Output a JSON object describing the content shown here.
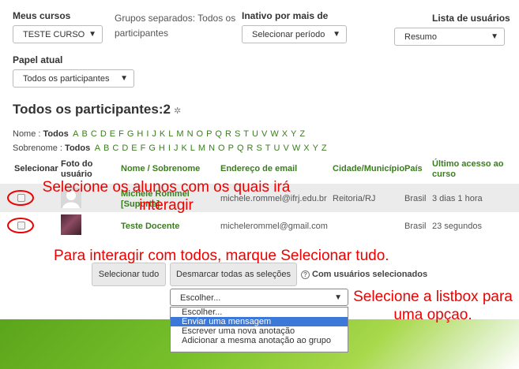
{
  "filters": {
    "my_courses_label": "Meus cursos",
    "my_courses_value": "TESTE CURSO",
    "groups_text": "Grupos separados: Todos os participantes",
    "inactive_label": "Inativo por mais de",
    "inactive_value": "Selecionar período",
    "user_list_label": "Lista de usuários",
    "user_list_value": "Resumo",
    "role_label": "Papel atual",
    "role_value": "Todos os participantes"
  },
  "heading": "Todos os participantes:2",
  "alphabet": {
    "name_label": "Nome :",
    "surname_label": "Sobrenome :",
    "all": "Todos",
    "letters": [
      "A",
      "B",
      "C",
      "D",
      "E",
      "F",
      "G",
      "H",
      "I",
      "J",
      "K",
      "L",
      "M",
      "N",
      "O",
      "P",
      "Q",
      "R",
      "S",
      "T",
      "U",
      "V",
      "W",
      "X",
      "Y",
      "Z"
    ]
  },
  "table": {
    "headers": {
      "select": "Selecionar",
      "photo": "Foto do usuário",
      "name": "Nome / Sobrenome",
      "email": "Endereço de email",
      "city": "Cidade/Município",
      "country": "País",
      "last_access": "Último acesso ao curso"
    },
    "rows": [
      {
        "name": "Michele Rommel [Suporte]",
        "email": "michele.rommel@ifrj.edu.br",
        "city": "Reitoria/RJ",
        "country": "Brasil",
        "last_access": "3 dias 1 hora"
      },
      {
        "name": "Teste Docente",
        "email": "michelerommel@gmail.com",
        "city": "",
        "country": "Brasil",
        "last_access": "23 segundos"
      }
    ]
  },
  "actions": {
    "select_all": "Selecionar tudo",
    "deselect_all": "Desmarcar todas as seleções",
    "with_selected": "Com usuários selecionados",
    "dropdown_value": "Escolher...",
    "options": [
      "Escolher...",
      "Enviar uma mensagem",
      "Escrever uma nova anotação",
      "Adicionar a mesma anotação ao grupo"
    ],
    "highlighted_option": "Enviar uma mensagem"
  },
  "annotations": {
    "select_students": "Selecione os alunos com os quais irá interagir",
    "interact_all": "Para interagir com todos, marque Selecionar tudo.",
    "select_listbox": "Selecione a listbox para uma opçao."
  },
  "colors": {
    "accent_green": "#3a7d1e",
    "annotation_red": "#e00000",
    "highlight_blue": "#3b78d8"
  }
}
